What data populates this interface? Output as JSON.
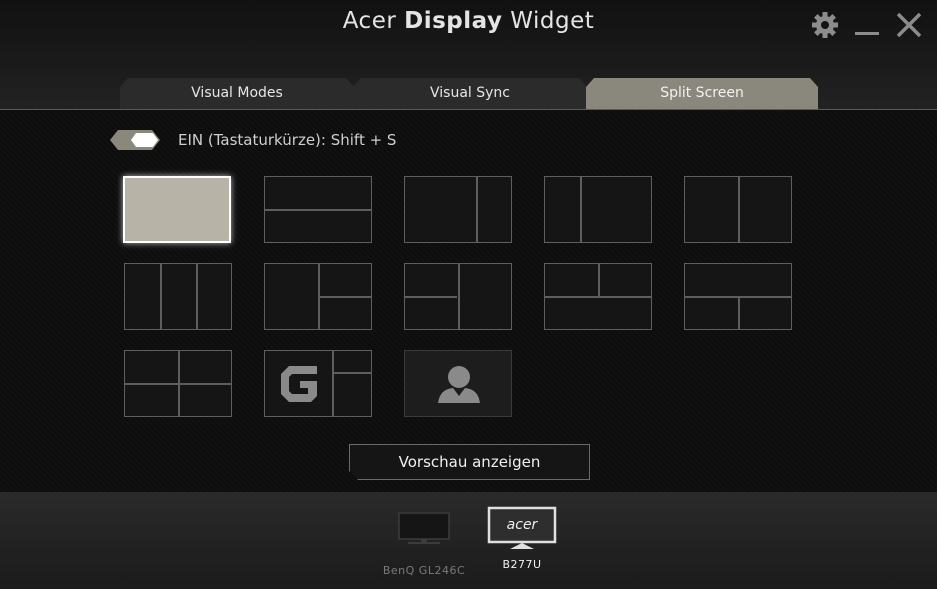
{
  "window": {
    "title_prefix": "Acer",
    "title_bold": "Display",
    "title_suffix": "Widget",
    "icons": [
      "gear-icon",
      "minimize-icon",
      "close-icon"
    ]
  },
  "tabs": [
    {
      "label": "Visual Modes",
      "active": false
    },
    {
      "label": "Visual Sync",
      "active": false
    },
    {
      "label": "Split Screen",
      "active": true
    }
  ],
  "split_screen": {
    "toggle_state": "on",
    "toggle_label": "EIN (Tastaturkürze): Shift + S",
    "layouts": [
      "full",
      "top-bottom",
      "left-wide-right-narrow",
      "left-narrow-right-wide",
      "left-right",
      "three-columns",
      "left-plus-right-two",
      "left-two-plus-right",
      "top-two-plus-bottom",
      "top-plus-bottom-two",
      "quad",
      "gaming-g",
      "user-profile"
    ],
    "selected_layout": "full",
    "preview_button": "Vorschau anzeigen"
  },
  "monitors": [
    {
      "name": "BenQ GL246C",
      "active": false
    },
    {
      "name": "B277U",
      "brand": "acer",
      "active": true
    }
  ],
  "colors": {
    "accent": "#8a877c",
    "selected_tile": "#b8b3a7",
    "background": "#0f0f0f"
  }
}
